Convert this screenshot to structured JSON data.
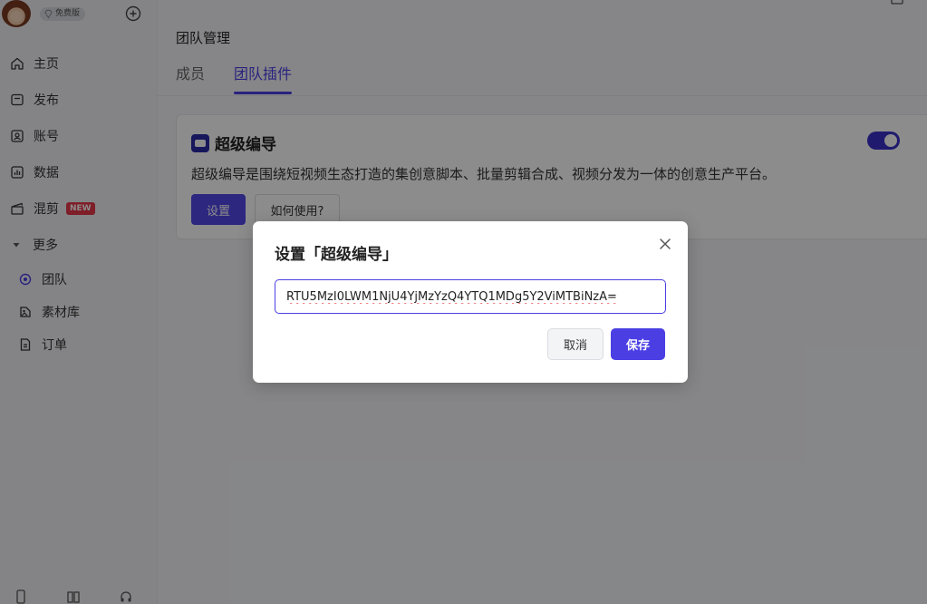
{
  "sidebar": {
    "profile": {
      "tier_label": "免费版"
    },
    "items": [
      {
        "label": "主页",
        "icon": "home-icon"
      },
      {
        "label": "发布",
        "icon": "publish-icon"
      },
      {
        "label": "账号",
        "icon": "account-icon"
      },
      {
        "label": "数据",
        "icon": "data-chart-icon"
      },
      {
        "label": "混剪",
        "icon": "clapperboard-icon",
        "badge": "NEW"
      },
      {
        "label": "更多",
        "icon": "caret-down-icon"
      },
      {
        "label": "团队",
        "icon": "team-icon"
      },
      {
        "label": "素材库",
        "icon": "material-library-icon"
      },
      {
        "label": "订单",
        "icon": "order-icon"
      }
    ]
  },
  "main": {
    "page_title": "团队管理",
    "tabs": [
      {
        "label": "成员"
      },
      {
        "label": "团队插件",
        "active": true
      }
    ],
    "plugin": {
      "name": "超级编导",
      "description": "超级编导是围绕短视频生态打造的集创意脚本、批量剪辑合成、视频分发为一体的创意生产平台。",
      "settings_label": "设置",
      "howto_label": "如何使用?",
      "enabled": true
    }
  },
  "modal": {
    "title": "设置「超级编导」",
    "input_value": "RTU5MzI0LWM1NjU4YjMzYzQ4YTQ1MDg5Y2ViMTBiNzA=",
    "cancel_label": "取消",
    "save_label": "保存"
  },
  "colors": {
    "accent": "#4b3fe4",
    "new_badge": "#e5384a"
  }
}
